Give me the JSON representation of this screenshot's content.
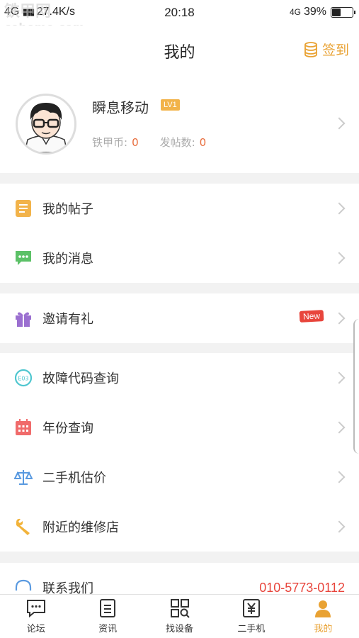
{
  "status_bar": {
    "network_left": "4G",
    "speed": "27.4K/s",
    "time": "20:18",
    "network_right": "4G",
    "battery": "39%",
    "battery_level": 0.39
  },
  "watermark": {
    "line1": "铁甲网",
    "line2": "cehome.com"
  },
  "header": {
    "title": "我的",
    "signin_label": "签到",
    "signin_icon": "coin-stack-icon"
  },
  "profile": {
    "name": "瞬息移动",
    "level": "LV1",
    "coin_label": "铁甲币:",
    "coin_value": "0",
    "posts_label": "发帖数:",
    "posts_value": "0"
  },
  "menu_groups": [
    [
      {
        "label": "我的帖子",
        "icon": "document-icon",
        "color": "#f2b34a"
      },
      {
        "label": "我的消息",
        "icon": "chat-bubble-icon",
        "color": "#5cc167"
      }
    ],
    [
      {
        "label": "邀请有礼",
        "icon": "gift-icon",
        "color": "#9b6fd0",
        "badge": "New"
      }
    ],
    [
      {
        "label": "故障代码查询",
        "icon": "error-code-icon",
        "color": "#4fc6cf"
      },
      {
        "label": "年份查询",
        "icon": "calendar-icon",
        "color": "#f06b6b"
      },
      {
        "label": "二手机估价",
        "icon": "scale-icon",
        "color": "#5a9ae0"
      },
      {
        "label": "附近的维修店",
        "icon": "wrench-icon",
        "color": "#f2b33a"
      }
    ]
  ],
  "contact": {
    "label": "联系我们",
    "phone": "010-5773-0112",
    "icon": "headset-icon"
  },
  "tabbar": [
    {
      "label": "论坛",
      "icon": "forum-icon"
    },
    {
      "label": "资讯",
      "icon": "news-icon"
    },
    {
      "label": "找设备",
      "icon": "grid-search-icon"
    },
    {
      "label": "二手机",
      "icon": "yuan-icon"
    },
    {
      "label": "我的",
      "icon": "profile-icon"
    }
  ],
  "colors": {
    "accent": "#e9a233",
    "badge_red": "#e8453c",
    "coin_value": "#e86b3a"
  }
}
